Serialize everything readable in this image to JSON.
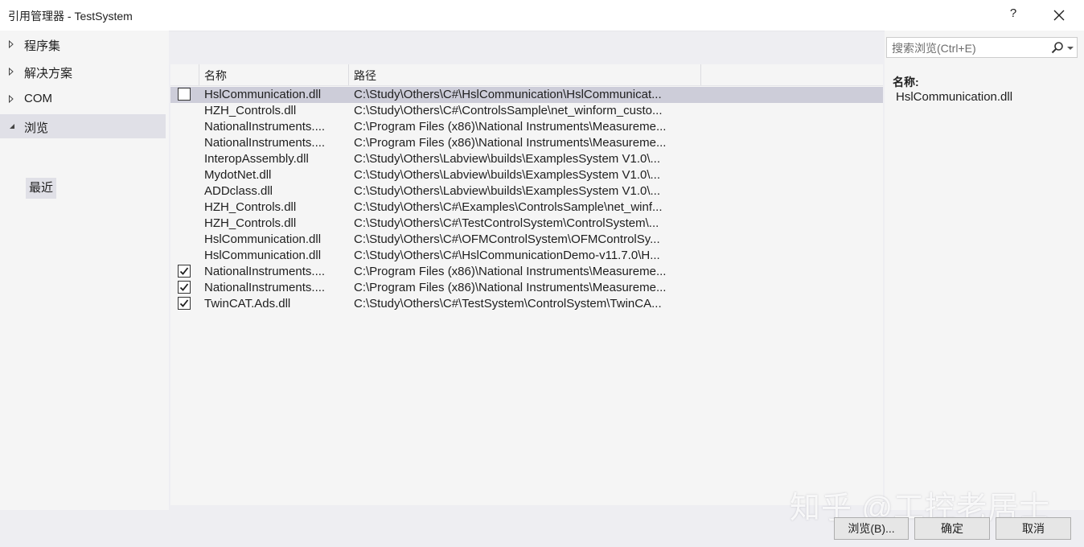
{
  "window": {
    "title": "引用管理器 - TestSystem",
    "help": "?"
  },
  "nav": {
    "items": [
      {
        "label": "程序集"
      },
      {
        "label": "解决方案"
      },
      {
        "label": "COM"
      },
      {
        "label": "浏览"
      }
    ],
    "sub_item": "最近"
  },
  "list": {
    "columns": {
      "name": "名称",
      "path": "路径"
    },
    "rows": [
      {
        "checked": false,
        "name": "HslCommunication.dll",
        "path": "C:\\Study\\Others\\C#\\HslCommunication\\HslCommunicat..."
      },
      {
        "checked": null,
        "name": "HZH_Controls.dll",
        "path": "C:\\Study\\Others\\C#\\ControlsSample\\net_winform_custo..."
      },
      {
        "checked": null,
        "name": "NationalInstruments....",
        "path": "C:\\Program Files (x86)\\National Instruments\\Measureme..."
      },
      {
        "checked": null,
        "name": "NationalInstruments....",
        "path": "C:\\Program Files (x86)\\National Instruments\\Measureme..."
      },
      {
        "checked": null,
        "name": "InteropAssembly.dll",
        "path": "C:\\Study\\Others\\Labview\\builds\\ExamplesSystem V1.0\\..."
      },
      {
        "checked": null,
        "name": "MydotNet.dll",
        "path": "C:\\Study\\Others\\Labview\\builds\\ExamplesSystem V1.0\\..."
      },
      {
        "checked": null,
        "name": "ADDclass.dll",
        "path": "C:\\Study\\Others\\Labview\\builds\\ExamplesSystem V1.0\\..."
      },
      {
        "checked": null,
        "name": "HZH_Controls.dll",
        "path": "C:\\Study\\Others\\C#\\Examples\\ControlsSample\\net_winf..."
      },
      {
        "checked": null,
        "name": "HZH_Controls.dll",
        "path": "C:\\Study\\Others\\C#\\TestControlSystem\\ControlSystem\\..."
      },
      {
        "checked": null,
        "name": "HslCommunication.dll",
        "path": "C:\\Study\\Others\\C#\\OFMControlSystem\\OFMControlSy..."
      },
      {
        "checked": null,
        "name": "HslCommunication.dll",
        "path": "C:\\Study\\Others\\C#\\HslCommunicationDemo-v11.7.0\\H..."
      },
      {
        "checked": true,
        "name": "NationalInstruments....",
        "path": "C:\\Program Files (x86)\\National Instruments\\Measureme..."
      },
      {
        "checked": true,
        "name": "NationalInstruments....",
        "path": "C:\\Program Files (x86)\\National Instruments\\Measureme..."
      },
      {
        "checked": true,
        "name": "TwinCAT.Ads.dll",
        "path": "C:\\Study\\Others\\C#\\TestSystem\\ControlSystem\\TwinCA..."
      }
    ]
  },
  "search": {
    "placeholder": "搜索浏览(Ctrl+E)"
  },
  "details": {
    "label": "名称:",
    "value": "HslCommunication.dll"
  },
  "watermark": "知乎 @工控老居士",
  "buttons": {
    "browse": "浏览(B)...",
    "ok": "确定",
    "cancel": "取消"
  },
  "colors": {
    "selection": "#cdcdd9",
    "panel": "#f5f5f5",
    "background": "#eeeef2"
  }
}
